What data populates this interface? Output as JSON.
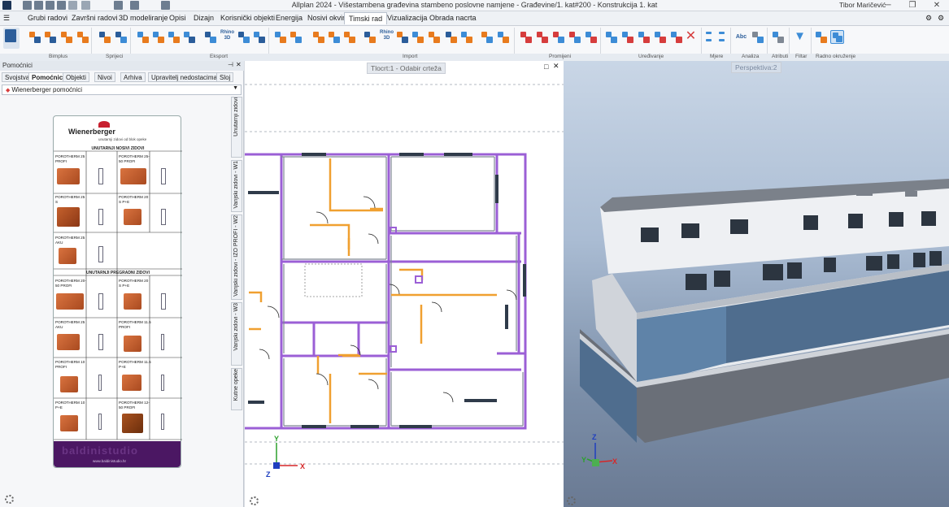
{
  "app": {
    "title": "Allplan 2024 - Višestambena građevina stambeno poslovne namjene - Građevine/1. kat#200 - Konstrukcija 1. kat",
    "user": "Tibor Maričević",
    "window_controls": [
      "─",
      "❐",
      "✕"
    ]
  },
  "menu": {
    "tabs": [
      "Grubi radovi",
      "Završni radovi",
      "3D modeliranje",
      "Opisi",
      "Dizajn",
      "Korisnički objekti",
      "Energija",
      "Nosivi okvir",
      "Timski rad",
      "Vizualizacija",
      "Obrada nacrta"
    ],
    "active": "Timski rad"
  },
  "ribbon": {
    "groups": [
      "Bimplus",
      "Sprijeci",
      "Eksport",
      "Import",
      "Promijeni",
      "Uređivanje",
      "Mjere",
      "Analiza",
      "Atributi",
      "Filtar",
      "Radno okruženje"
    ],
    "text_buttons": [
      "Rhino 3D",
      "Rhino 3D",
      "Abc"
    ],
    "accent_color": "#e87b1e"
  },
  "left_panel": {
    "header": "Pomoćnici",
    "tabs": [
      "Svojstva",
      "Pomoćnici",
      "Objekti",
      "Nivoi",
      "Arhiva",
      "Upravitelj nedostacima",
      "Sloj"
    ],
    "active_tab": "Pomoćnici",
    "dropdown_value": "Wienerberger pomoćnici",
    "catalog": {
      "brand": "Wienerberger",
      "subtitle": "unutarnji zidovi od blok opeke",
      "section1": "UNUTARNJI NOSIVI ZIDOVI",
      "section2": "UNUTARNJI PREGRADNI ZIDOVI",
      "items": [
        {
          "name": "POROTHERM 25 PROFI"
        },
        {
          "name": "POROTHERM 25-50 PROFI"
        },
        {
          "name": "POROTHERM 25 S"
        },
        {
          "name": "POROTHERM 20 S P+E"
        },
        {
          "name": "POROTHERM 25 AKU"
        },
        {
          "name": "POROTHERM 20-50 PROFI"
        },
        {
          "name": "POROTHERM 20 S P+E"
        },
        {
          "name": "POROTHERM 25 AKU"
        },
        {
          "name": "POROTHERM 11.5 PROFI"
        },
        {
          "name": "POROTHERM 10 PROFI"
        },
        {
          "name": "POROTHERM 11.5 P+E"
        },
        {
          "name": "POROTHERM 10 P+E"
        },
        {
          "name": "POROTHERM 12-50 PROFI"
        }
      ],
      "footer_brand": "baldinistudio",
      "footer_url": "www.baldinistudio.hr"
    },
    "vertical_tabs": [
      "Unutarnji zidovi",
      "Vanjski zidovi - W1",
      "Vanjski zidovi - IZO PROFI - W2",
      "Vanjski zidovi - W3",
      "Kutne opeke"
    ]
  },
  "plan_view": {
    "label": "Tlocrt:1 - Odabir crteža",
    "axis_x": "X",
    "axis_y": "Y",
    "axis_z": "Z"
  },
  "view3d": {
    "label": "Perspektiva:2",
    "axis_x": "X",
    "axis_y": "Y",
    "axis_z": "Z"
  },
  "colors": {
    "wall_purple": "#9b5fd6",
    "door_orange": "#f0a030",
    "wall_gray": "#7f8894"
  }
}
